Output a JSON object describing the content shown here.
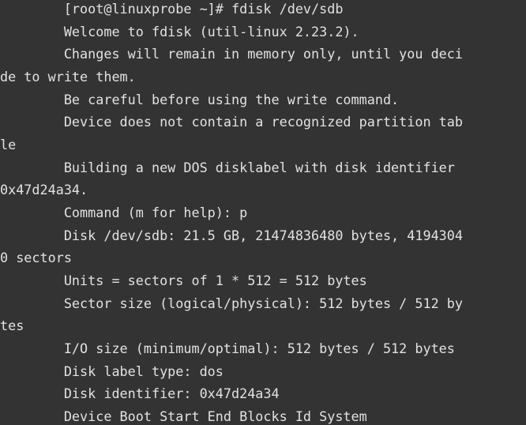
{
  "terminal": {
    "lines": [
      "        [root@linuxprobe ~]# fdisk /dev/sdb",
      "        Welcome to fdisk (util-linux 2.23.2).",
      "        Changes will remain in memory only, until you deci",
      "de to write them.",
      "        Be careful before using the write command.",
      "        Device does not contain a recognized partition tab",
      "le",
      "        Building a new DOS disklabel with disk identifier ",
      "0x47d24a34.",
      "        Command (m for help): p",
      "        Disk /dev/sdb: 21.5 GB, 21474836480 bytes, 4194304",
      "0 sectors",
      "        Units = sectors of 1 * 512 = 512 bytes",
      "        Sector size (logical/physical): 512 bytes / 512 by",
      "tes",
      "        I/O size (minimum/optimal): 512 bytes / 512 bytes",
      "        Disk label type: dos",
      "        Disk identifier: 0x47d24a34",
      "        Device Boot Start End Blocks Id System"
    ]
  }
}
